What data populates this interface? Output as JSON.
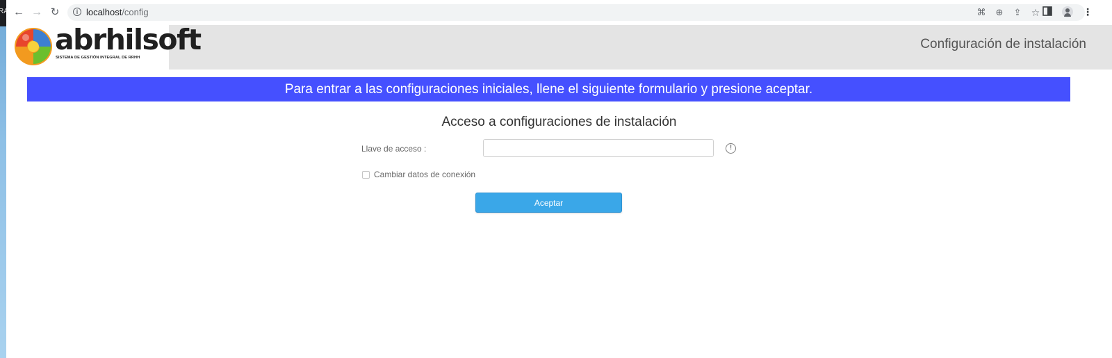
{
  "desktop": {
    "edge_text": "RA"
  },
  "browser": {
    "url_host": "localhost",
    "url_path": "/config",
    "icons": [
      "back-icon",
      "forward-icon",
      "reload-icon",
      "info-icon",
      "translate-icon",
      "zoom-icon",
      "share-icon",
      "star-icon",
      "side-panel-icon",
      "profile-icon",
      "menu-icon"
    ]
  },
  "header": {
    "logo_text": "abrhilsoft",
    "logo_subtitle": "SISTEMA DE GESTIÓN INTEGRAL DE RRHH",
    "page_title": "Configuración de instalación"
  },
  "banner": {
    "text": "Para entrar a las configuraciones iniciales, llene el siguiente formulario y presione aceptar.",
    "color": "#4550ff"
  },
  "form": {
    "title": "Acceso a configuraciones de instalación",
    "key_label": "Llave de acceso :",
    "key_value": "",
    "change_connection_label": "Cambiar datos de conexión",
    "change_connection_checked": false,
    "accept_label": "Aceptar",
    "accept_color": "#3aa7e8"
  }
}
